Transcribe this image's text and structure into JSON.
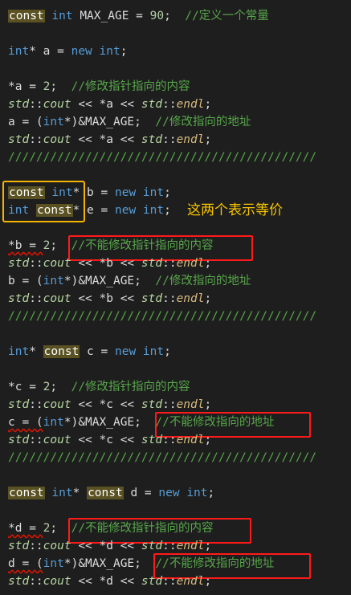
{
  "colors": {
    "background": "#1e1e1e",
    "keyword": "#569cd6",
    "comment": "#57a64a",
    "namespace": "#b8d7a3",
    "highlight_box_red": "#ff1a1a",
    "highlight_box_yellow": "#f5b400",
    "annotation_text": "#f7c400"
  },
  "code": {
    "l1": {
      "kw": "const",
      "type": "int",
      "rest": " MAX_AGE = ",
      "num": "90",
      "semi": ";  ",
      "comment": "//定义一个常量"
    },
    "l2": {
      "type": "int",
      "rest1": "* a = ",
      "new": "new",
      "type2": "int",
      "semi": ";"
    },
    "l3": {
      "pre": "*a = ",
      "num": "2",
      "semi": ";  ",
      "comment": "//修改指针指向的内容"
    },
    "l4": {
      "ns": "std",
      "cc": "::",
      "fn": "cout",
      "mid": " << *a << ",
      "ns2": "std",
      "cc2": "::",
      "endl": "endl",
      "semi": ";"
    },
    "l5": {
      "pre": "a = (",
      "type": "int",
      "rest": "*)&MAX_AGE;  ",
      "comment": "//修改指向的地址"
    },
    "l6": {
      "ns": "std",
      "cc": "::",
      "fn": "cout",
      "mid": " << *a << ",
      "ns2": "std",
      "cc2": "::",
      "endl": "endl",
      "semi": ";"
    },
    "sep1": "////////////////////////////////////////////",
    "l7": {
      "kw": "const",
      "type": "int",
      "rest": "* b = ",
      "new": "new",
      "type2": "int",
      "semi": ";"
    },
    "l8": {
      "type": "int",
      "kw": "const",
      "rest": "* e = ",
      "new": "new",
      "type2": "int",
      "semi": ";"
    },
    "annotation": "这两个表示等价",
    "l9": {
      "pre": "*b = ",
      "num": "2",
      "semi": ";  ",
      "comment": "//不能修改指针指向的内容"
    },
    "l10": {
      "ns": "std",
      "cc": "::",
      "fn": "cout",
      "mid": " << *b << ",
      "ns2": "std",
      "cc2": "::",
      "endl": "endl",
      "semi": ";"
    },
    "l11": {
      "pre": "b = (",
      "type": "int",
      "rest": "*)&MAX_AGE;  ",
      "comment": "//修改指向的地址"
    },
    "l12": {
      "ns": "std",
      "cc": "::",
      "fn": "cout",
      "mid": " << *b << ",
      "ns2": "std",
      "cc2": "::",
      "endl": "endl",
      "semi": ";"
    },
    "sep2": "////////////////////////////////////////////",
    "l13": {
      "type": "int",
      "mid": "* ",
      "kw": "const",
      "rest": " c = ",
      "new": "new",
      "type2": "int",
      "semi": ";"
    },
    "l14": {
      "pre": "*c = ",
      "num": "2",
      "semi": ";  ",
      "comment": "//修改指针指向的内容"
    },
    "l15": {
      "ns": "std",
      "cc": "::",
      "fn": "cout",
      "mid": " << *c << ",
      "ns2": "std",
      "cc2": "::",
      "endl": "endl",
      "semi": ";"
    },
    "l16": {
      "pre": "c = (",
      "type": "int",
      "rest": "*)&MAX_AGE;  ",
      "comment": "//不能修改指向的地址"
    },
    "l17": {
      "ns": "std",
      "cc": "::",
      "fn": "cout",
      "mid": " << *c << ",
      "ns2": "std",
      "cc2": "::",
      "endl": "endl",
      "semi": ";"
    },
    "sep3": "////////////////////////////////////////////",
    "l18": {
      "kw": "const",
      "type": "int",
      "mid": "* ",
      "kw2": "const",
      "rest": " d = ",
      "new": "new",
      "type2": "int",
      "semi": ";"
    },
    "l19": {
      "pre": "*d = ",
      "num": "2",
      "semi": ";  ",
      "comment": "//不能修改指针指向的内容"
    },
    "l20": {
      "ns": "std",
      "cc": "::",
      "fn": "cout",
      "mid": " << *d << ",
      "ns2": "std",
      "cc2": "::",
      "endl": "endl",
      "semi": ";"
    },
    "l21": {
      "pre": "d = (",
      "type": "int",
      "rest": "*)&MAX_AGE;  ",
      "comment": "//不能修改指向的地址"
    },
    "l22": {
      "ns": "std",
      "cc": "::",
      "fn": "cout",
      "mid": " << *d << ",
      "ns2": "std",
      "cc2": "::",
      "endl": "endl",
      "semi": ";"
    }
  }
}
